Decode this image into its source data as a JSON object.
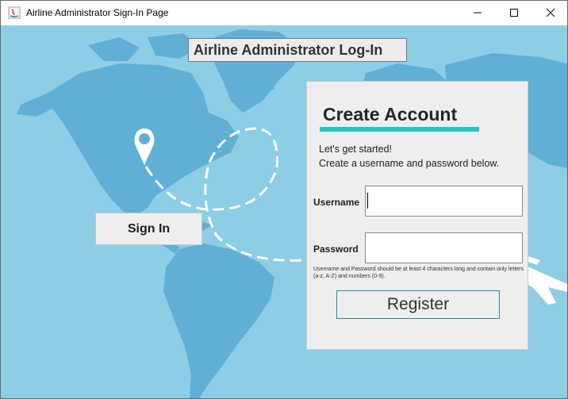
{
  "window": {
    "title": "Airline Administrator Sign-In Page",
    "controls": {
      "minimize": "minimize-icon",
      "maximize": "maximize-icon",
      "close": "close-icon"
    }
  },
  "header": {
    "title": "Airline Administrator Log-In"
  },
  "sign_in": {
    "label": "Sign In"
  },
  "create_account": {
    "title": "Create Account",
    "intro_line_1": "Let's get started!",
    "intro_line_2": "Create a username and password below.",
    "username_label": "Username",
    "username_value": "",
    "password_label": "Password",
    "password_value": "",
    "hint": "Username and Password should be at least 4 characters long and contain only letters (a-z, A-Z) and numbers (0-9).",
    "register_label": "Register"
  },
  "colors": {
    "background": "#8ecde6",
    "land": "#5fb0d4",
    "accent": "#1ec9c3",
    "register_border": "#2a8f96"
  },
  "icons": {
    "app": "java-app-icon",
    "map_pin": "location-pin-icon",
    "airplane": "airplane-icon"
  }
}
